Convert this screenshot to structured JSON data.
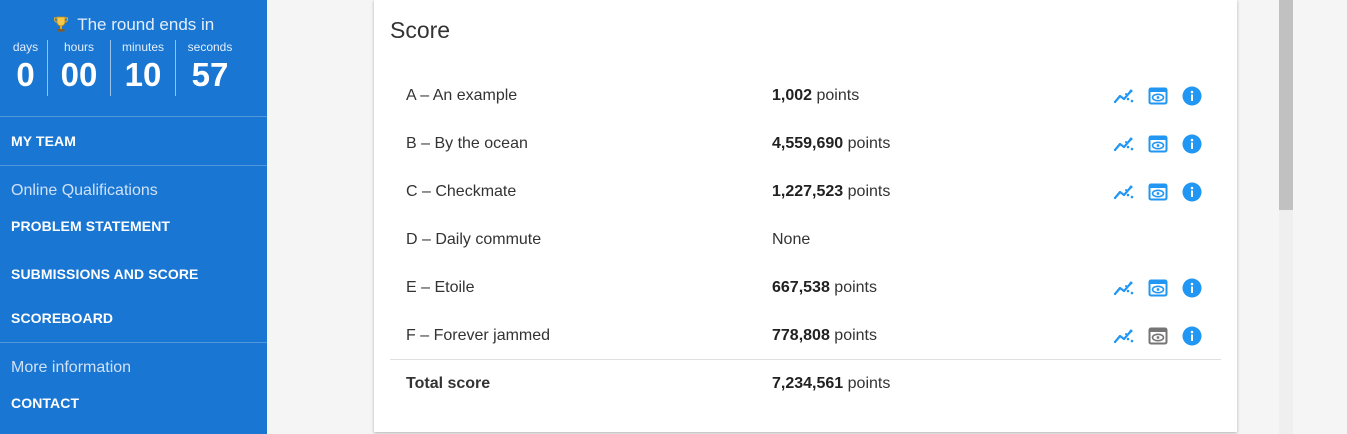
{
  "sidebar": {
    "timer": {
      "title": "The round ends in",
      "units": [
        {
          "label": "days",
          "value": "0"
        },
        {
          "label": "hours",
          "value": "00"
        },
        {
          "label": "minutes",
          "value": "10"
        },
        {
          "label": "seconds",
          "value": "57"
        }
      ]
    },
    "my_team": "MY TEAM",
    "section1": {
      "heading": "Online Qualifications",
      "items": [
        "PROBLEM STATEMENT",
        "SUBMISSIONS AND SCORE",
        "SCOREBOARD"
      ]
    },
    "section2": {
      "heading": "More information",
      "items": [
        "CONTACT"
      ]
    }
  },
  "score_card": {
    "title": "Score",
    "rows": [
      {
        "name": "A – An example",
        "points": "1,002",
        "unit": "points",
        "has_actions": true,
        "view_active": true
      },
      {
        "name": "B – By the ocean",
        "points": "4,559,690",
        "unit": "points",
        "has_actions": true,
        "view_active": true
      },
      {
        "name": "C – Checkmate",
        "points": "1,227,523",
        "unit": "points",
        "has_actions": true,
        "view_active": true
      },
      {
        "name": "D – Daily commute",
        "points": "",
        "unit": "None",
        "has_actions": false,
        "view_active": false
      },
      {
        "name": "E – Etoile",
        "points": "667,538",
        "unit": "points",
        "has_actions": true,
        "view_active": true
      },
      {
        "name": "F – Forever jammed",
        "points": "778,808",
        "unit": "points",
        "has_actions": true,
        "view_active": false
      }
    ],
    "total": {
      "label": "Total score",
      "points": "7,234,561",
      "unit": "points"
    }
  },
  "icons": {
    "chart": "chart-icon",
    "view": "view-icon",
    "info": "info-icon"
  },
  "colors": {
    "sidebar": "#1976d2",
    "accent": "#2196f3",
    "inactive_icon": "#757575"
  }
}
